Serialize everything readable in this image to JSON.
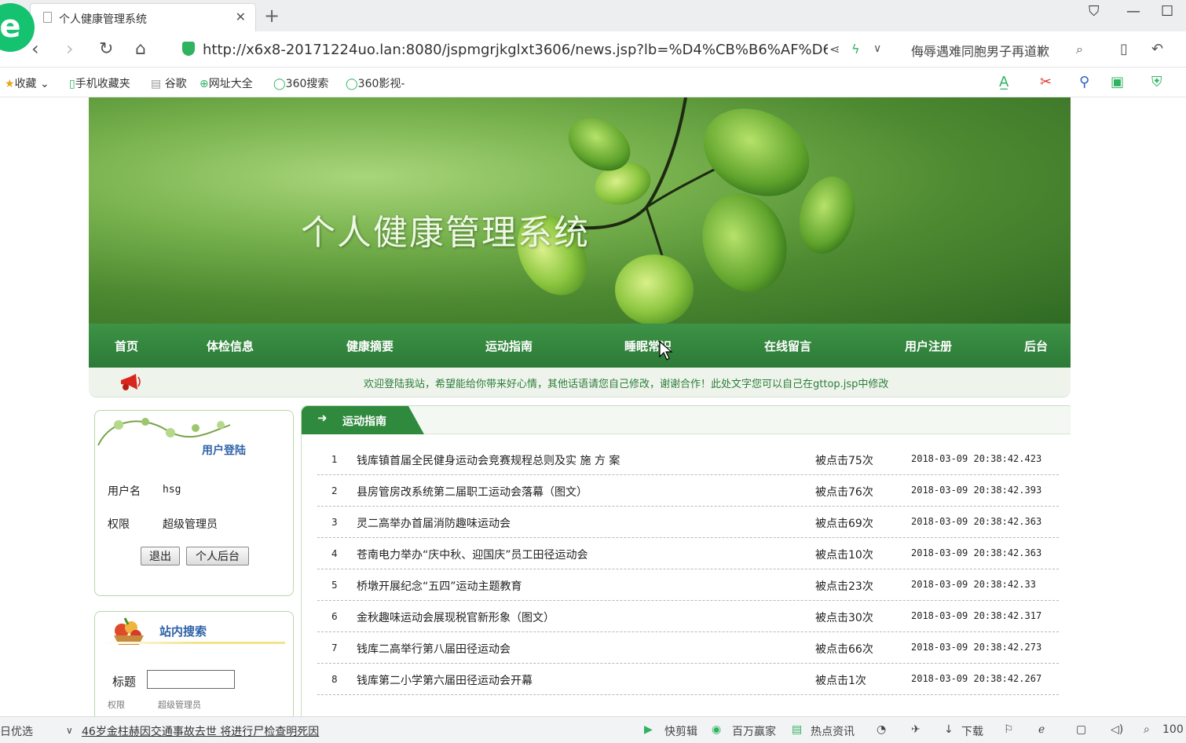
{
  "browser": {
    "tab_title": "个人健康管理系统",
    "url": "http://x6x8-20171224uo.lan:8080/jspmgrjkglxt3606/news.jsp?lb=%D4%CB%B6%AF%D6",
    "search_suggest": "侮辱遇难同胞男子再道歉",
    "bookmarks": [
      "收藏",
      "手机收藏夹",
      "谷歌",
      "网址大全",
      "360搜索",
      "360影视-"
    ]
  },
  "site": {
    "banner_title": "个人健康管理系统",
    "nav": [
      "首页",
      "体检信息",
      "健康摘要",
      "运动指南",
      "睡眠常识",
      "在线留言",
      "用户注册",
      "后台"
    ],
    "marquee": "欢迎登陆我站，希望能给你带来好心情，其他话语请您自己修改，谢谢合作！此处文字您可以自己在gttop.jsp中修改"
  },
  "login": {
    "heading": "用户登陆",
    "username_label": "用户名",
    "username": "hsg",
    "role_label": "权限",
    "role": "超级管理员",
    "logout_label": "退出",
    "backend_label": "个人后台"
  },
  "search": {
    "heading": "站内搜索",
    "title_label": "标题",
    "clip_label": "权限",
    "clip_value": "超级管理员"
  },
  "news": {
    "section_title": "运动指南",
    "items": [
      {
        "num": "1",
        "title": "钱库镇首届全民健身运动会竞赛规程总则及实 施 方 案",
        "clicks": "被点击75次",
        "date": "2018-03-09 20:38:42.423"
      },
      {
        "num": "2",
        "title": "县房管房改系统第二届职工运动会落幕（图文）",
        "clicks": "被点击76次",
        "date": "2018-03-09 20:38:42.393"
      },
      {
        "num": "3",
        "title": "灵二高举办首届消防趣味运动会",
        "clicks": "被点击69次",
        "date": "2018-03-09 20:38:42.363"
      },
      {
        "num": "4",
        "title": "苍南电力举办“庆中秋、迎国庆”员工田径运动会",
        "clicks": "被点击10次",
        "date": "2018-03-09 20:38:42.363"
      },
      {
        "num": "5",
        "title": "桥墩开展纪念“五四”运动主题教育",
        "clicks": "被点击23次",
        "date": "2018-03-09 20:38:42.33"
      },
      {
        "num": "6",
        "title": "金秋趣味运动会展现税官新形象（图文）",
        "clicks": "被点击30次",
        "date": "2018-03-09 20:38:42.317"
      },
      {
        "num": "7",
        "title": "钱库二高举行第八届田径运动会",
        "clicks": "被点击66次",
        "date": "2018-03-09 20:38:42.273"
      },
      {
        "num": "8",
        "title": "钱库第二小学第六届田径运动会开幕",
        "clicks": "被点击1次",
        "date": "2018-03-09 20:38:42.267"
      }
    ]
  },
  "status_bar": {
    "left": "日优选",
    "ticker": "46岁金柱赫因交通事故去世 将进行尸检查明死因",
    "items": [
      "快剪辑",
      "百万赢家",
      "热点资讯",
      "下载"
    ],
    "zoom": "100"
  }
}
